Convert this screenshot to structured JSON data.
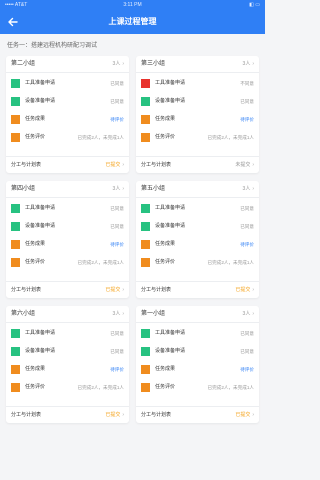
{
  "statusbar": {
    "carrier": "••••• AT&T",
    "time": "3:11 PM",
    "battery": "◧ ▭"
  },
  "header": {
    "title": "上课过程管理"
  },
  "task": {
    "title": "任务一：搭建远程机构研配习调试"
  },
  "colors": {
    "accent": "#2f7ff5",
    "green": "#27c281",
    "orange": "#f08c1e",
    "red": "#e8322d"
  },
  "groups": [
    {
      "name": "第二小组",
      "count": "3人",
      "rows": [
        {
          "label": "工具准备申请",
          "status": "已同意",
          "color": "#27c281",
          "status_style": "gray"
        },
        {
          "label": "设备准备申请",
          "status": "已同意",
          "color": "#27c281",
          "status_style": "gray"
        },
        {
          "label": "任务成果",
          "status": "待评价",
          "color": "#f08c1e",
          "status_style": "blue"
        },
        {
          "label": "任务评价",
          "status": "已完成2人，未完成1人",
          "color": "#f08c1e",
          "status_style": "gray"
        }
      ],
      "footer": {
        "label": "分工与计划表",
        "status": "已提交",
        "status_style": "orange"
      }
    },
    {
      "name": "第三小组",
      "count": "3人",
      "rows": [
        {
          "label": "工具准备申请",
          "status": "不同意",
          "color": "#e8322d",
          "status_style": "gray"
        },
        {
          "label": "设备准备申请",
          "status": "已同意",
          "color": "#27c281",
          "status_style": "gray"
        },
        {
          "label": "任务成果",
          "status": "待评价",
          "color": "#f08c1e",
          "status_style": "blue"
        },
        {
          "label": "任务评价",
          "status": "已完成2人，未完成1人",
          "color": "#f08c1e",
          "status_style": "gray"
        }
      ],
      "footer": {
        "label": "分工与计划表",
        "status": "未提交",
        "status_style": "gray"
      }
    },
    {
      "name": "第四小组",
      "count": "3人",
      "rows": [
        {
          "label": "工具准备申请",
          "status": "已同意",
          "color": "#27c281",
          "status_style": "gray"
        },
        {
          "label": "设备准备申请",
          "status": "已同意",
          "color": "#27c281",
          "status_style": "gray"
        },
        {
          "label": "任务成果",
          "status": "待评价",
          "color": "#f08c1e",
          "status_style": "blue"
        },
        {
          "label": "任务评价",
          "status": "已完成2人，未完成1人",
          "color": "#f08c1e",
          "status_style": "gray"
        }
      ],
      "footer": {
        "label": "分工与计划表",
        "status": "已提交",
        "status_style": "orange"
      }
    },
    {
      "name": "第五小组",
      "count": "3人",
      "rows": [
        {
          "label": "工具准备申请",
          "status": "已同意",
          "color": "#27c281",
          "status_style": "gray"
        },
        {
          "label": "设备准备申请",
          "status": "已同意",
          "color": "#27c281",
          "status_style": "gray"
        },
        {
          "label": "任务成果",
          "status": "待评价",
          "color": "#f08c1e",
          "status_style": "blue"
        },
        {
          "label": "任务评价",
          "status": "已完成2人，未完成1人",
          "color": "#f08c1e",
          "status_style": "gray"
        }
      ],
      "footer": {
        "label": "分工与计划表",
        "status": "已提交",
        "status_style": "orange"
      }
    },
    {
      "name": "第六小组",
      "count": "3人",
      "rows": [
        {
          "label": "工具准备申请",
          "status": "已同意",
          "color": "#27c281",
          "status_style": "gray"
        },
        {
          "label": "设备准备申请",
          "status": "已同意",
          "color": "#27c281",
          "status_style": "gray"
        },
        {
          "label": "任务成果",
          "status": "待评价",
          "color": "#f08c1e",
          "status_style": "blue"
        },
        {
          "label": "任务评价",
          "status": "已完成2人，未完成1人",
          "color": "#f08c1e",
          "status_style": "gray"
        }
      ],
      "footer": {
        "label": "分工与计划表",
        "status": "已提交",
        "status_style": "orange"
      }
    },
    {
      "name": "第一小组",
      "count": "3人",
      "rows": [
        {
          "label": "工具准备申请",
          "status": "已同意",
          "color": "#27c281",
          "status_style": "gray"
        },
        {
          "label": "设备准备申请",
          "status": "已同意",
          "color": "#27c281",
          "status_style": "gray"
        },
        {
          "label": "任务成果",
          "status": "待评价",
          "color": "#f08c1e",
          "status_style": "blue"
        },
        {
          "label": "任务评价",
          "status": "已完成2人，未完成1人",
          "color": "#f08c1e",
          "status_style": "gray"
        }
      ],
      "footer": {
        "label": "分工与计划表",
        "status": "已提交",
        "status_style": "orange"
      }
    }
  ]
}
